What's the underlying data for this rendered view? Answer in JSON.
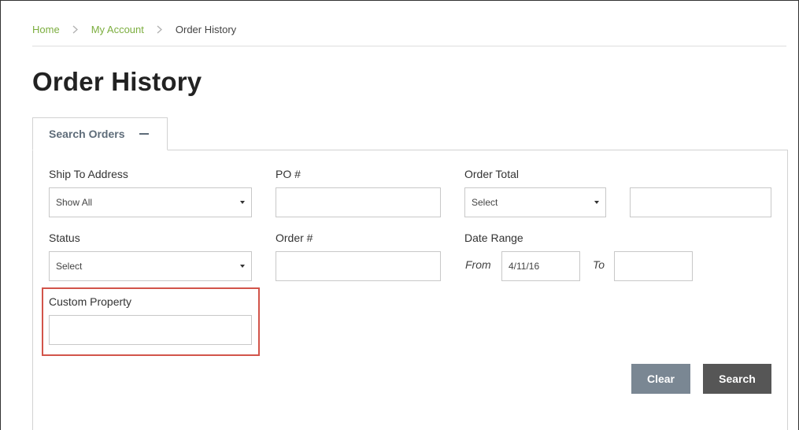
{
  "breadcrumb": {
    "items": [
      {
        "label": "Home"
      },
      {
        "label": "My Account"
      },
      {
        "label": "Order History"
      }
    ]
  },
  "page": {
    "title": "Order History"
  },
  "tab": {
    "label": "Search Orders"
  },
  "form": {
    "ship_to": {
      "label": "Ship To Address",
      "value": "Show All"
    },
    "po": {
      "label": "PO #",
      "value": ""
    },
    "order_total": {
      "label": "Order Total",
      "select_value": "Select",
      "amount": ""
    },
    "status": {
      "label": "Status",
      "value": "Select"
    },
    "order_number": {
      "label": "Order #",
      "value": ""
    },
    "date_range": {
      "label": "Date Range",
      "from_label": "From",
      "from_value": "4/11/16",
      "to_label": "To",
      "to_value": ""
    },
    "custom_property": {
      "label": "Custom Property",
      "value": ""
    }
  },
  "actions": {
    "clear_label": "Clear",
    "search_label": "Search"
  },
  "colors": {
    "link": "#7cae3f",
    "clear_button": "#7a8793",
    "search_button": "#565656",
    "highlight": "#d2544a"
  }
}
